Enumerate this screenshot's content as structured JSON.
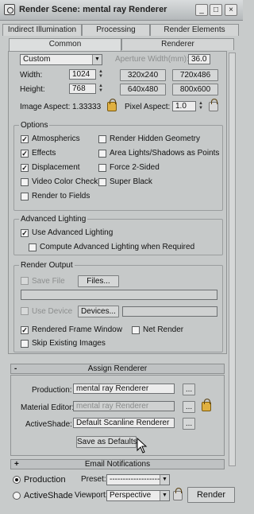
{
  "window": {
    "title": "Render Scene: mental ray Renderer",
    "buttons": {
      "minimize": "_",
      "maximize": "□",
      "close": "×"
    }
  },
  "tabs": {
    "row1": [
      "Indirect Illumination",
      "Processing",
      "Render Elements"
    ],
    "row2": [
      "Common",
      "Renderer"
    ],
    "active": "Common"
  },
  "output_size": {
    "preset_value": "Custom",
    "aperture_label": "Aperture Width(mm):",
    "aperture_value": "36.0",
    "width_label": "Width:",
    "width_value": "1024",
    "height_label": "Height:",
    "height_value": "768",
    "presets": [
      "320x240",
      "720x486",
      "640x480",
      "800x600"
    ],
    "image_aspect_label": "Image Aspect:",
    "image_aspect_value": "1.33333",
    "pixel_aspect_label": "Pixel Aspect:",
    "pixel_aspect_value": "1.0"
  },
  "options": {
    "title": "Options",
    "left": [
      {
        "label": "Atmospherics",
        "checked": true
      },
      {
        "label": "Effects",
        "checked": true
      },
      {
        "label": "Displacement",
        "checked": true
      },
      {
        "label": "Video Color Check",
        "checked": false
      },
      {
        "label": "Render to Fields",
        "checked": false
      }
    ],
    "right": [
      {
        "label": "Render Hidden Geometry",
        "checked": false
      },
      {
        "label": "Area Lights/Shadows as Points",
        "checked": false
      },
      {
        "label": "Force 2-Sided",
        "checked": false
      },
      {
        "label": "Super Black",
        "checked": false
      }
    ]
  },
  "advanced_lighting": {
    "title": "Advanced Lighting",
    "items": [
      {
        "label": "Use Advanced Lighting",
        "checked": true
      },
      {
        "label": "Compute Advanced Lighting when Required",
        "checked": false
      }
    ]
  },
  "render_output": {
    "title": "Render Output",
    "save_file_label": "Save File",
    "files_button": "Files...",
    "use_device_label": "Use Device",
    "devices_button": "Devices...",
    "rendered_frame_window_label": "Rendered Frame Window",
    "rendered_frame_window_checked": true,
    "net_render_label": "Net Render",
    "net_render_checked": false,
    "skip_existing_label": "Skip Existing Images",
    "skip_existing_checked": false
  },
  "assign_renderer": {
    "header": "Assign Renderer",
    "sign": "-",
    "production_label": "Production:",
    "production_value": "mental ray Renderer",
    "material_editor_label": "Material Editor:",
    "material_editor_value": "mental ray Renderer",
    "activeshade_label": "ActiveShade:",
    "activeshade_value": "Default Scanline Renderer",
    "browse_label": "...",
    "save_defaults_button": "Save as Defaults"
  },
  "email_notifications": {
    "header": "Email Notifications",
    "sign": "+"
  },
  "footer": {
    "production_label": "Production",
    "activeshade_label": "ActiveShade",
    "production_selected": true,
    "preset_label": "Preset:",
    "preset_value": "--------------------",
    "viewport_label": "Viewport:",
    "viewport_value": "Perspective",
    "render_button": "Render"
  }
}
